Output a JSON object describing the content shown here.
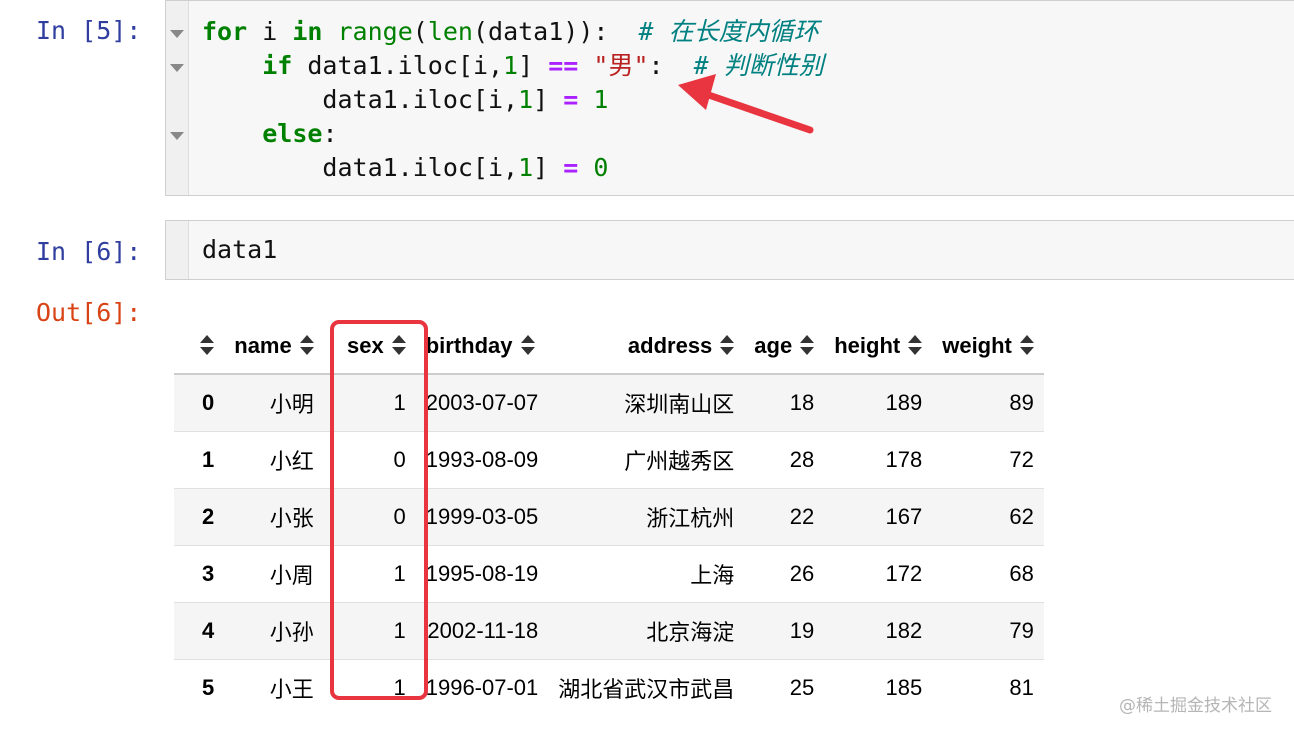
{
  "cells": [
    {
      "prompt": "In [5]:",
      "code_lines": [
        [
          {
            "t": "kw",
            "v": "for"
          },
          {
            "t": "",
            "v": " i "
          },
          {
            "t": "kw",
            "v": "in"
          },
          {
            "t": "",
            "v": " "
          },
          {
            "t": "bi",
            "v": "range"
          },
          {
            "t": "",
            "v": "("
          },
          {
            "t": "bi",
            "v": "len"
          },
          {
            "t": "",
            "v": "(data1)):  "
          },
          {
            "t": "cm",
            "v": "# 在长度内循环"
          }
        ],
        [
          {
            "t": "",
            "v": "    "
          },
          {
            "t": "kw",
            "v": "if"
          },
          {
            "t": "",
            "v": " data1.iloc[i,"
          },
          {
            "t": "num",
            "v": "1"
          },
          {
            "t": "",
            "v": "] "
          },
          {
            "t": "op",
            "v": "=="
          },
          {
            "t": "",
            "v": " "
          },
          {
            "t": "str",
            "v": "\"男\""
          },
          {
            "t": "",
            "v": ":  "
          },
          {
            "t": "cm",
            "v": "# 判断性别"
          }
        ],
        [
          {
            "t": "",
            "v": "        data1.iloc[i,"
          },
          {
            "t": "num",
            "v": "1"
          },
          {
            "t": "",
            "v": "] "
          },
          {
            "t": "op",
            "v": "="
          },
          {
            "t": "",
            "v": " "
          },
          {
            "t": "num",
            "v": "1"
          }
        ],
        [
          {
            "t": "",
            "v": "    "
          },
          {
            "t": "kw",
            "v": "else"
          },
          {
            "t": "",
            "v": ":"
          }
        ],
        [
          {
            "t": "",
            "v": "        data1.iloc[i,"
          },
          {
            "t": "num",
            "v": "1"
          },
          {
            "t": "",
            "v": "] "
          },
          {
            "t": "op",
            "v": "="
          },
          {
            "t": "",
            "v": " "
          },
          {
            "t": "num",
            "v": "0"
          }
        ]
      ]
    },
    {
      "prompt": "In [6]:",
      "code_lines": [
        [
          {
            "t": "",
            "v": "data1"
          }
        ]
      ]
    }
  ],
  "output": {
    "prompt": "Out[6]:",
    "table": {
      "columns": [
        "name",
        "sex",
        "birthday",
        "address",
        "age",
        "height",
        "weight"
      ],
      "rows": [
        {
          "index": "0",
          "values": [
            "小明",
            "1",
            "2003-07-07",
            "深圳南山区",
            "18",
            "189",
            "89"
          ]
        },
        {
          "index": "1",
          "values": [
            "小红",
            "0",
            "1993-08-09",
            "广州越秀区",
            "28",
            "178",
            "72"
          ]
        },
        {
          "index": "2",
          "values": [
            "小张",
            "0",
            "1999-03-05",
            "浙江杭州",
            "22",
            "167",
            "62"
          ]
        },
        {
          "index": "3",
          "values": [
            "小周",
            "1",
            "1995-08-19",
            "上海",
            "26",
            "172",
            "68"
          ]
        },
        {
          "index": "4",
          "values": [
            "小孙",
            "1",
            "2002-11-18",
            "北京海淀",
            "19",
            "182",
            "79"
          ]
        },
        {
          "index": "5",
          "values": [
            "小王",
            "1",
            "1996-07-01",
            "湖北省武汉市武昌",
            "25",
            "185",
            "81"
          ]
        }
      ]
    }
  },
  "annotation_color": "#e8353f",
  "watermark": "@稀土掘金技术社区"
}
